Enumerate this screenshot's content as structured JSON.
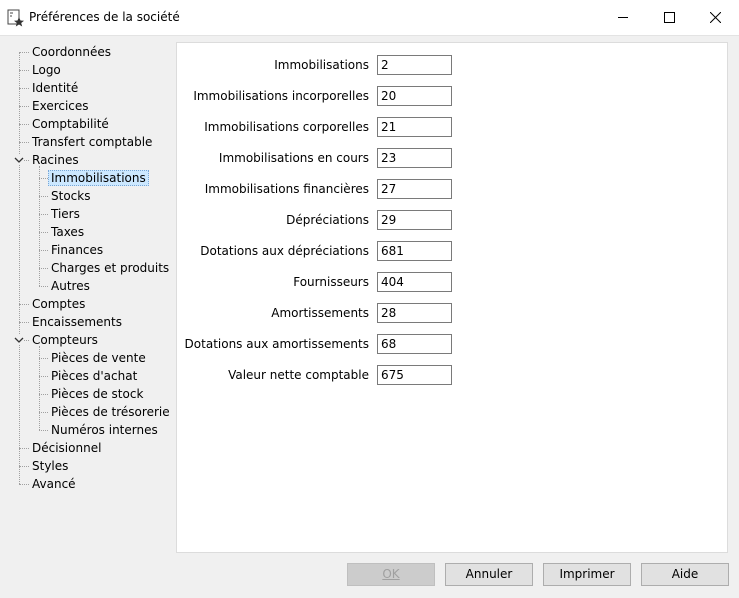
{
  "window": {
    "title": "Préférences de la société"
  },
  "tree": [
    {
      "label": "Coordonnées"
    },
    {
      "label": "Logo"
    },
    {
      "label": "Identité"
    },
    {
      "label": "Exercices"
    },
    {
      "label": "Comptabilité"
    },
    {
      "label": "Transfert comptable"
    },
    {
      "label": "Racines",
      "expanded": true
    },
    {
      "label": "Immobilisations",
      "selected": true
    },
    {
      "label": "Stocks"
    },
    {
      "label": "Tiers"
    },
    {
      "label": "Taxes"
    },
    {
      "label": "Finances"
    },
    {
      "label": "Charges et produits"
    },
    {
      "label": "Autres"
    },
    {
      "label": "Comptes"
    },
    {
      "label": "Encaissements"
    },
    {
      "label": "Compteurs",
      "expanded": true
    },
    {
      "label": "Pièces de vente"
    },
    {
      "label": "Pièces d'achat"
    },
    {
      "label": "Pièces de stock"
    },
    {
      "label": "Pièces de trésorerie"
    },
    {
      "label": "Numéros internes"
    },
    {
      "label": "Décisionnel"
    },
    {
      "label": "Styles"
    },
    {
      "label": "Avancé"
    }
  ],
  "fields": [
    {
      "label": "Immobilisations",
      "value": "2"
    },
    {
      "label": "Immobilisations incorporelles",
      "value": "20"
    },
    {
      "label": "Immobilisations corporelles",
      "value": "21"
    },
    {
      "label": "Immobilisations en cours",
      "value": "23"
    },
    {
      "label": "Immobilisations financières",
      "value": "27"
    },
    {
      "label": "Dépréciations",
      "value": "29"
    },
    {
      "label": "Dotations aux dépréciations",
      "value": "681"
    },
    {
      "label": "Fournisseurs",
      "value": "404"
    },
    {
      "label": "Amortissements",
      "value": "28"
    },
    {
      "label": "Dotations aux amortissements",
      "value": "68"
    },
    {
      "label": "Valeur nette comptable",
      "value": "675"
    }
  ],
  "buttons": {
    "ok": {
      "label": "OK",
      "enabled": false
    },
    "annuler": {
      "label": "Annuler",
      "enabled": true
    },
    "imprimer": {
      "label": "Imprimer",
      "enabled": true
    },
    "aide": {
      "label": "Aide",
      "enabled": true
    }
  }
}
